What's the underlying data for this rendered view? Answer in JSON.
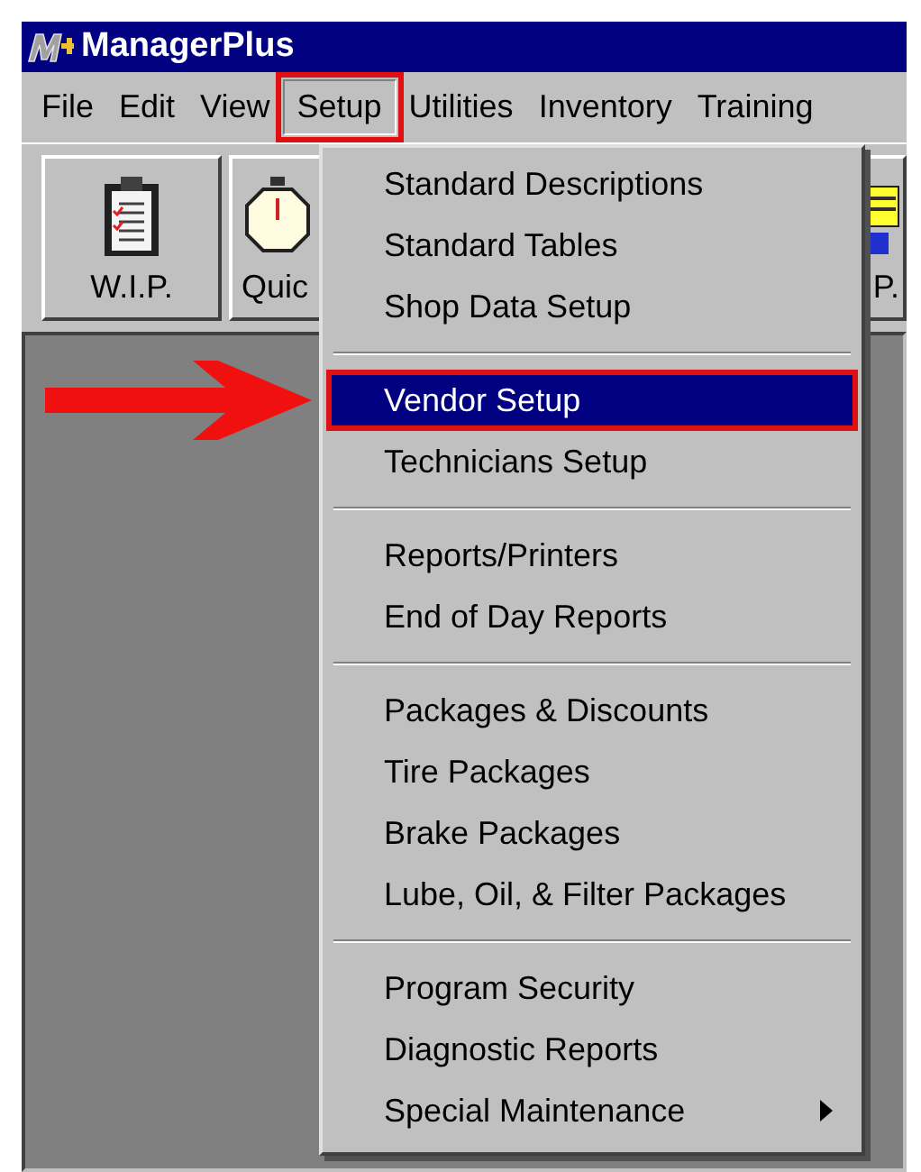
{
  "window": {
    "title": "ManagerPlus"
  },
  "menu_bar": [
    {
      "label": "File",
      "selected": false,
      "highlighted": false
    },
    {
      "label": "Edit",
      "selected": false,
      "highlighted": false
    },
    {
      "label": "View",
      "selected": false,
      "highlighted": false
    },
    {
      "label": "Setup",
      "selected": true,
      "highlighted": true
    },
    {
      "label": "Utilities",
      "selected": false,
      "highlighted": false
    },
    {
      "label": "Inventory",
      "selected": false,
      "highlighted": false
    },
    {
      "label": "Training",
      "selected": false,
      "highlighted": false
    }
  ],
  "toolbar": [
    {
      "label": "W.I.P.",
      "kind": "clipboard"
    },
    {
      "label": "Quic",
      "kind": "stopwatch"
    },
    {
      "label": "P.",
      "kind": "document"
    }
  ],
  "dropdown": {
    "groups": [
      [
        {
          "label": "Standard Descriptions",
          "selected": false,
          "highlighted": false,
          "submenu": false
        },
        {
          "label": "Standard Tables",
          "selected": false,
          "highlighted": false,
          "submenu": false
        },
        {
          "label": "Shop Data Setup",
          "selected": false,
          "highlighted": false,
          "submenu": false
        }
      ],
      [
        {
          "label": "Vendor Setup",
          "selected": true,
          "highlighted": true,
          "submenu": false
        },
        {
          "label": "Technicians Setup",
          "selected": false,
          "highlighted": false,
          "submenu": false
        }
      ],
      [
        {
          "label": "Reports/Printers",
          "selected": false,
          "highlighted": false,
          "submenu": false
        },
        {
          "label": "End of Day Reports",
          "selected": false,
          "highlighted": false,
          "submenu": false
        }
      ],
      [
        {
          "label": "Packages & Discounts",
          "selected": false,
          "highlighted": false,
          "submenu": false
        },
        {
          "label": "Tire Packages",
          "selected": false,
          "highlighted": false,
          "submenu": false
        },
        {
          "label": "Brake Packages",
          "selected": false,
          "highlighted": false,
          "submenu": false
        },
        {
          "label": "Lube, Oil, & Filter Packages",
          "selected": false,
          "highlighted": false,
          "submenu": false
        }
      ],
      [
        {
          "label": "Program Security",
          "selected": false,
          "highlighted": false,
          "submenu": false
        },
        {
          "label": "Diagnostic Reports",
          "selected": false,
          "highlighted": false,
          "submenu": false
        },
        {
          "label": "Special Maintenance",
          "selected": false,
          "highlighted": false,
          "submenu": true
        }
      ]
    ]
  }
}
